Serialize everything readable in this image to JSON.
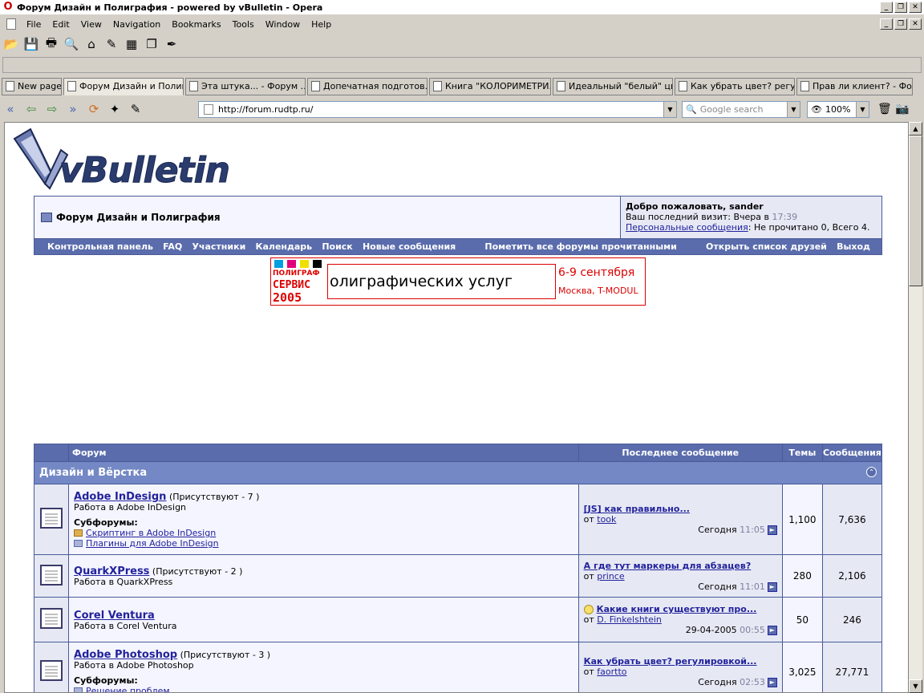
{
  "window": {
    "title": "Форум Дизайн и Полиграфия - powered by vBulletin - Opera"
  },
  "menu": [
    "File",
    "Edit",
    "View",
    "Navigation",
    "Bookmarks",
    "Tools",
    "Window",
    "Help"
  ],
  "tabs": [
    {
      "label": "New page"
    },
    {
      "label": "Форум Дизайн и Полигр..."
    },
    {
      "label": "Эта штука... - Форум ..."
    },
    {
      "label": "Допечатная подготов..."
    },
    {
      "label": "Книга \"КОЛОРИМЕТРИ..."
    },
    {
      "label": "Идеальный \"белый\" цв..."
    },
    {
      "label": "Как убрать цвет? регу..."
    },
    {
      "label": "Прав ли клиент? - Фор..."
    }
  ],
  "address": {
    "url": "http://forum.rudtp.ru/"
  },
  "search": {
    "placeholder": "Google search"
  },
  "zoom": {
    "level": "100%"
  },
  "logo": {
    "text": "vBulletin"
  },
  "header": {
    "forum_title": "Форум Дизайн и Полиграфия",
    "welcome": "Добро пожаловать, sander",
    "last_visit_label": "Ваш последний визит: Вчера в",
    "last_visit_time": "17:39",
    "pm_link": "Персональные сообщения",
    "pm_status": ": Не прочитано 0, Всего 4."
  },
  "navlinks": [
    "Контрольная панель",
    "FAQ",
    "Участники",
    "Календарь",
    "Поиск",
    "Новые сообщения",
    "Пометить все форумы прочитанными",
    "Открыть список друзей",
    "Выход"
  ],
  "banner": {
    "logo_line1": "ПОЛИГРАФ",
    "logo_line2": "СЕРВИС",
    "logo_line3": "2005",
    "text": "олиграфических услуг",
    "date": "6-9 сентября",
    "place": "Москва, T-MODUL"
  },
  "table": {
    "headers": {
      "forum": "Форум",
      "last_post": "Последнее сообщение",
      "threads": "Темы",
      "posts": "Сообщения"
    },
    "category": "Дизайн и Вёрстка",
    "rows": [
      {
        "name": "Adobe InDesign",
        "present": "(Присутствуют - 7 )",
        "desc": "Работа в Adobe InDesign",
        "subforums_label": "Субфорумы:",
        "subforums": [
          "Скриптинг в Adobe InDesign",
          "Плагины для Adobe InDesign"
        ],
        "last_title": "[JS] как правильно...",
        "by": "от",
        "author": "took",
        "date": "Сегодня",
        "time": "11:05",
        "threads": "1,100",
        "posts": "7,636"
      },
      {
        "name": "QuarkXPress",
        "present": "(Присутствуют - 2 )",
        "desc": "Работа в QuarkXPress",
        "last_title": "А где тут маркеры для абзацев?",
        "by": "от",
        "author": "prince",
        "date": "Сегодня",
        "time": "11:01",
        "threads": "280",
        "posts": "2,106"
      },
      {
        "name": "Corel Ventura",
        "present": "",
        "desc": "Работа в Corel Ventura",
        "last_title": "Какие книги существуют про...",
        "by": "от",
        "author": "D. Finkelshtein",
        "date": "29-04-2005",
        "time": "00:55",
        "threads": "50",
        "posts": "246"
      },
      {
        "name": "Adobe Photoshop",
        "present": "(Присутствуют - 3 )",
        "desc": "Работа в Adobe Photoshop",
        "subforums_label": "Субфорумы:",
        "subforums": [
          "Решение проблем"
        ],
        "last_title": "Как убрать цвет? регулировкой...",
        "by": "от",
        "author": "faortto",
        "date": "Сегодня",
        "time": "02:53",
        "threads": "3,025",
        "posts": "27,771"
      }
    ]
  },
  "colors": {
    "nav_blue": "#5a6cac",
    "category_blue": "#7388c4",
    "link": "#22229c",
    "banner_red": "#dd0000"
  }
}
